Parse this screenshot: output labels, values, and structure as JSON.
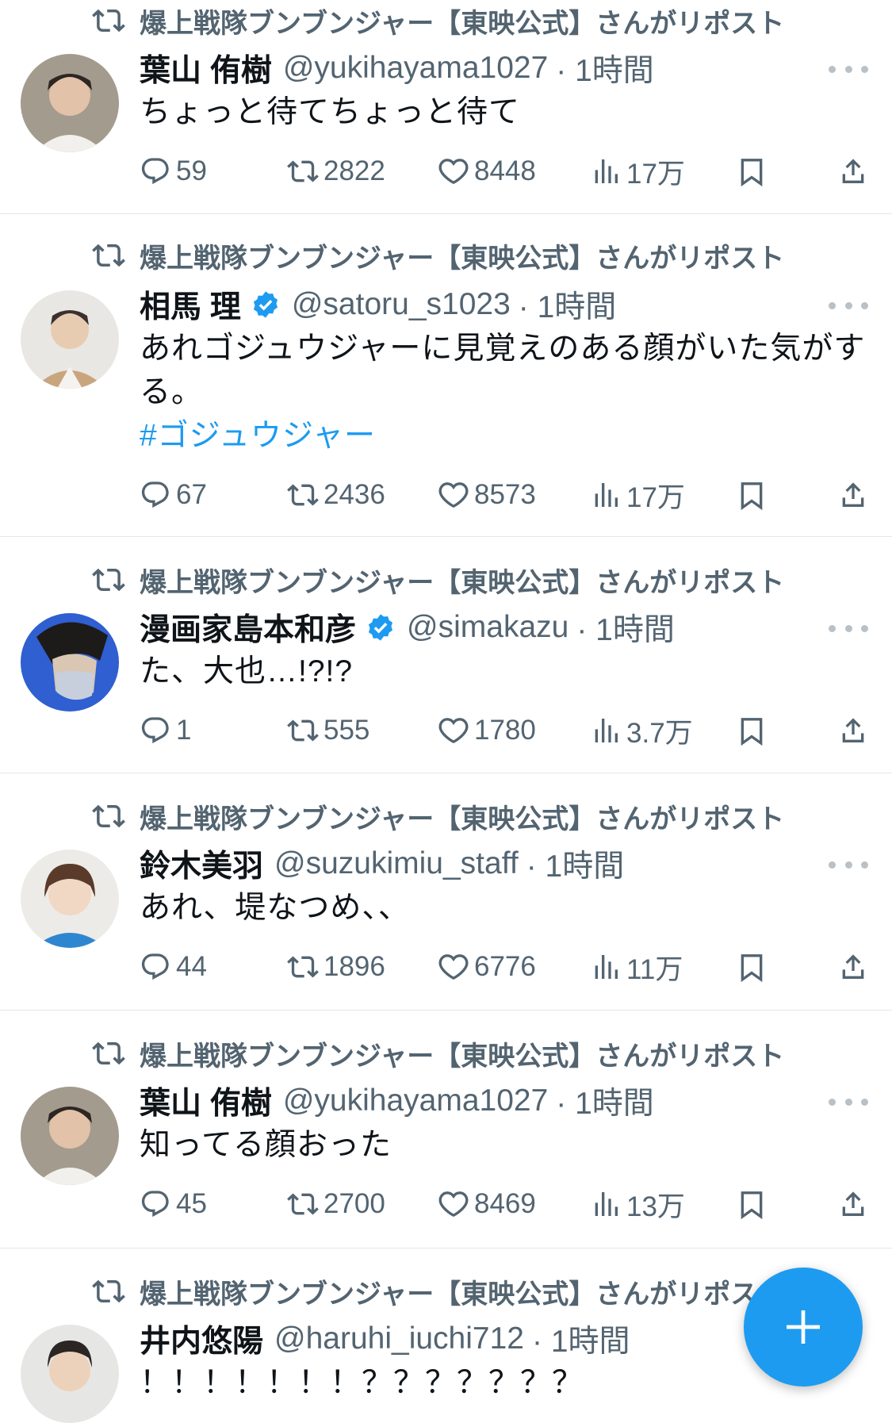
{
  "colors": {
    "accent": "#1d9bf0",
    "text": "#0f1419",
    "muted": "#536471",
    "divider": "#e3e6e9"
  },
  "tweets": [
    {
      "repost_label": "爆上戦隊ブンブンジャー【東映公式】さんがリポスト",
      "name": "葉山 侑樹",
      "verified": false,
      "handle": "@yukihayama1027",
      "time": "· 1時間",
      "text": "ちょっと待てちょっと待て",
      "hashtag": "",
      "replies": "59",
      "reposts": "2822",
      "likes": "8448",
      "views": "17万"
    },
    {
      "repost_label": "爆上戦隊ブンブンジャー【東映公式】さんがリポスト",
      "name": "相馬 理",
      "verified": true,
      "handle": "@satoru_s1023",
      "time": "· 1時間",
      "text": "あれゴジュウジャーに見覚えのある顔がいた気がする。",
      "hashtag": "#ゴジュウジャー",
      "replies": "67",
      "reposts": "2436",
      "likes": "8573",
      "views": "17万"
    },
    {
      "repost_label": "爆上戦隊ブンブンジャー【東映公式】さんがリポスト",
      "name": "漫画家島本和彦",
      "verified": true,
      "handle": "@simakazu",
      "time": "· 1時間",
      "text": "た、大也…!?!?",
      "hashtag": "",
      "replies": "1",
      "reposts": "555",
      "likes": "1780",
      "views": "3.7万"
    },
    {
      "repost_label": "爆上戦隊ブンブンジャー【東映公式】さんがリポスト",
      "name": "鈴木美羽",
      "verified": false,
      "handle": "@suzukimiu_staff",
      "time": "· 1時間",
      "text": "あれ、堤なつめ、、",
      "hashtag": "",
      "replies": "44",
      "reposts": "1896",
      "likes": "6776",
      "views": "11万"
    },
    {
      "repost_label": "爆上戦隊ブンブンジャー【東映公式】さんがリポスト",
      "name": "葉山 侑樹",
      "verified": false,
      "handle": "@yukihayama1027",
      "time": "· 1時間",
      "text": "知ってる顔おった",
      "hashtag": "",
      "replies": "45",
      "reposts": "2700",
      "likes": "8469",
      "views": "13万"
    },
    {
      "repost_label": "爆上戦隊ブンブンジャー【東映公式】さんがリポスト",
      "name": "井内悠陽",
      "verified": false,
      "handle": "@haruhi_iuchi712",
      "time": "· 1時間",
      "text": "！！！！！！！？？？？？？？",
      "hashtag": "",
      "replies": "",
      "reposts": "",
      "likes": "",
      "views": ""
    }
  ],
  "fab": {
    "icon": "plus-icon"
  }
}
